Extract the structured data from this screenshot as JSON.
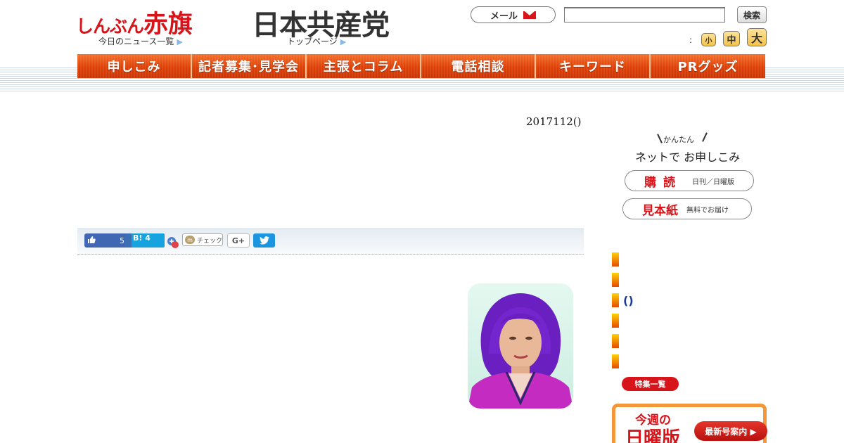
{
  "header": {
    "logo_akahata_small": "しんぶん",
    "logo_akahata_big": "赤旗",
    "logo_jcp": "日本共産党",
    "news_list_link": "今日のニュース一覧",
    "top_page_link": "トップページ",
    "mail_label": "メール",
    "search_input_value": "",
    "search_button": "検索",
    "size_colon": ":",
    "size_small": "小",
    "size_medium": "中",
    "size_large": "大"
  },
  "nav": {
    "items": [
      {
        "label": "申しこみ"
      },
      {
        "label": "記者募集･見学会"
      },
      {
        "label": "主張とコラム"
      },
      {
        "label": "電話相談"
      },
      {
        "label": "キーワード"
      },
      {
        "label": "PRグッズ"
      }
    ]
  },
  "article": {
    "date": "2017112()"
  },
  "social": {
    "fb_like_count": "5",
    "hatena_label": "B!",
    "hatena_count": "4",
    "mixi_check": "チェック",
    "gplus": "G+"
  },
  "sidebar": {
    "kantan": "かんたん",
    "net_apply": "ネットで お申しこみ",
    "koudoku": "購読",
    "koudoku_sub": "日刊／日曜版",
    "mihonshi": "見本紙",
    "mihonshi_sub": "無料でお届け",
    "link_paren": "()",
    "tokushu": "特集一覧",
    "kinshu": "今週の",
    "nichiyoban": "日曜版",
    "newest_issue": "最新号案内 ▶"
  },
  "colors": {
    "brand_red": "#d8141b",
    "nav_orange": "#de3f06",
    "link_blue": "#1a3a9e"
  }
}
